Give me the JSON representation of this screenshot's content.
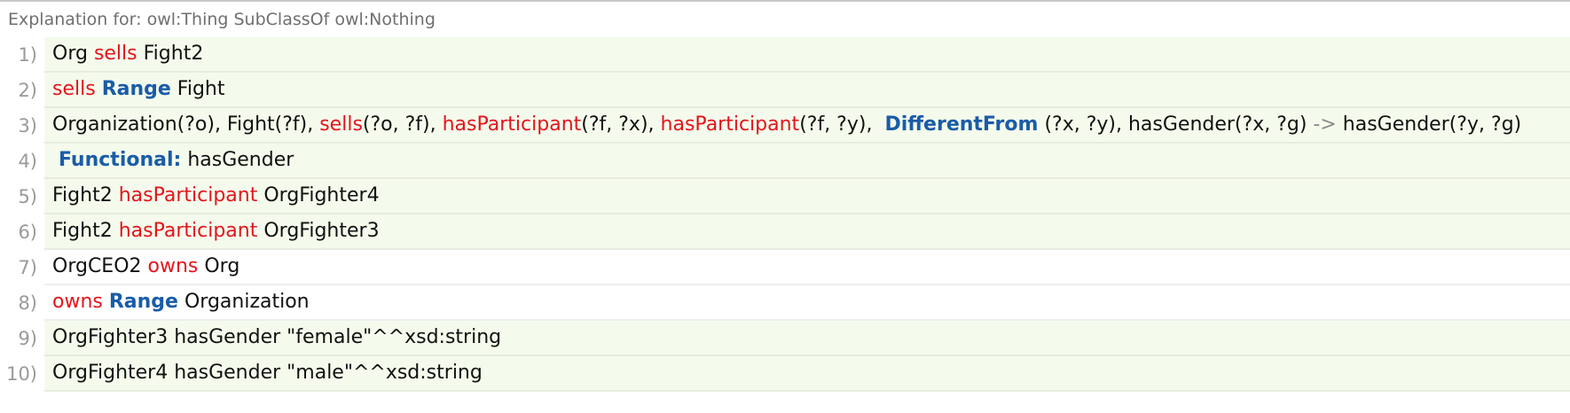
{
  "header": {
    "title": "Explanation for: owl:Thing SubClassOf owl:Nothing"
  },
  "colors": {
    "property": "#e4141b",
    "keyword": "#1a5ca8",
    "operator": "#8a8a8a",
    "row_bg": "#f4fbec"
  },
  "rows": [
    {
      "num": "1)",
      "plain": false,
      "tokens": [
        {
          "t": "Org ",
          "k": "n"
        },
        {
          "t": "sells",
          "k": "p"
        },
        {
          "t": " Fight2",
          "k": "n"
        }
      ]
    },
    {
      "num": "2)",
      "plain": false,
      "tokens": [
        {
          "t": "sells",
          "k": "p"
        },
        {
          "t": " ",
          "k": "n"
        },
        {
          "t": "Range",
          "k": "k"
        },
        {
          "t": " Fight",
          "k": "n"
        }
      ]
    },
    {
      "num": "3)",
      "plain": false,
      "tokens": [
        {
          "t": "Organization(?o), Fight(?f), ",
          "k": "n"
        },
        {
          "t": "sells",
          "k": "p"
        },
        {
          "t": "(?o, ?f), ",
          "k": "n"
        },
        {
          "t": "hasParticipant",
          "k": "p"
        },
        {
          "t": "(?f, ?x), ",
          "k": "n"
        },
        {
          "t": "hasParticipant",
          "k": "p"
        },
        {
          "t": "(?f, ?y),  ",
          "k": "n"
        },
        {
          "t": "DifferentFrom",
          "k": "k"
        },
        {
          "t": " (?x, ?y), hasGender(?x, ?g) ",
          "k": "n"
        },
        {
          "t": "->",
          "k": "o"
        },
        {
          "t": " hasGender(?y, ?g)",
          "k": "n"
        }
      ]
    },
    {
      "num": "4)",
      "plain": false,
      "tokens": [
        {
          "t": " ",
          "k": "n"
        },
        {
          "t": "Functional:",
          "k": "k"
        },
        {
          "t": " hasGender",
          "k": "n"
        }
      ]
    },
    {
      "num": "5)",
      "plain": false,
      "tokens": [
        {
          "t": "Fight2 ",
          "k": "n"
        },
        {
          "t": "hasParticipant",
          "k": "p"
        },
        {
          "t": " OrgFighter4",
          "k": "n"
        }
      ]
    },
    {
      "num": "6)",
      "plain": false,
      "tokens": [
        {
          "t": "Fight2 ",
          "k": "n"
        },
        {
          "t": "hasParticipant",
          "k": "p"
        },
        {
          "t": " OrgFighter3",
          "k": "n"
        }
      ]
    },
    {
      "num": "7)",
      "plain": true,
      "tokens": [
        {
          "t": "OrgCEO2 ",
          "k": "n"
        },
        {
          "t": "owns",
          "k": "p"
        },
        {
          "t": " Org",
          "k": "n"
        }
      ]
    },
    {
      "num": "8)",
      "plain": true,
      "tokens": [
        {
          "t": "owns",
          "k": "p"
        },
        {
          "t": " ",
          "k": "n"
        },
        {
          "t": "Range",
          "k": "k"
        },
        {
          "t": " Organization",
          "k": "n"
        }
      ]
    },
    {
      "num": "9)",
      "plain": false,
      "tokens": [
        {
          "t": "OrgFighter3 hasGender \"female\"^^xsd:string",
          "k": "n"
        }
      ]
    },
    {
      "num": "10)",
      "plain": false,
      "tokens": [
        {
          "t": "OrgFighter4 hasGender \"male\"^^xsd:string",
          "k": "n"
        }
      ]
    }
  ]
}
